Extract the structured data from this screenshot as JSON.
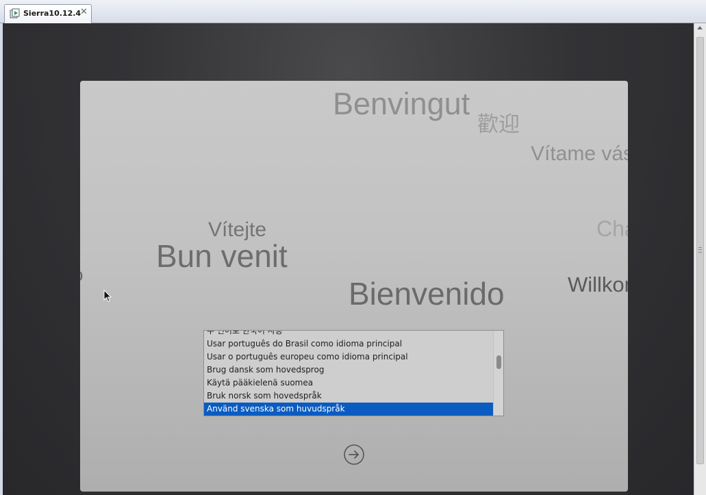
{
  "tab": {
    "title": "Sierra10.12.4",
    "icon": "vm-icon",
    "close_label": "✕"
  },
  "welcome_words": {
    "benvingut": "Benvingut",
    "chinese": "歡迎",
    "vitame": "Vítame vás",
    "cha": "Chà",
    "vitejte": "Vítejte",
    "bunvenit": "Bun venit",
    "willkommen": "Willkommen",
    "bienvenido": "Bienvenido",
    "edge": "o"
  },
  "language_list": {
    "items": [
      "주 언어로 한국어 사용",
      "Usar português do Brasil como idioma principal",
      "Usar o português europeu como idioma principal",
      "Brug dansk som hovedsprog",
      "Käytä pääkielenä suomea",
      "Bruk norsk som hovedspråk",
      "Använd svenska som huvudspråk"
    ],
    "selected_index": 6
  },
  "next_button": {
    "icon": "arrow-right-circle-icon"
  },
  "colors": {
    "selection": "#0b5cc1",
    "installer_bg": "#c2c2c2",
    "vm_bg": "#333336"
  }
}
